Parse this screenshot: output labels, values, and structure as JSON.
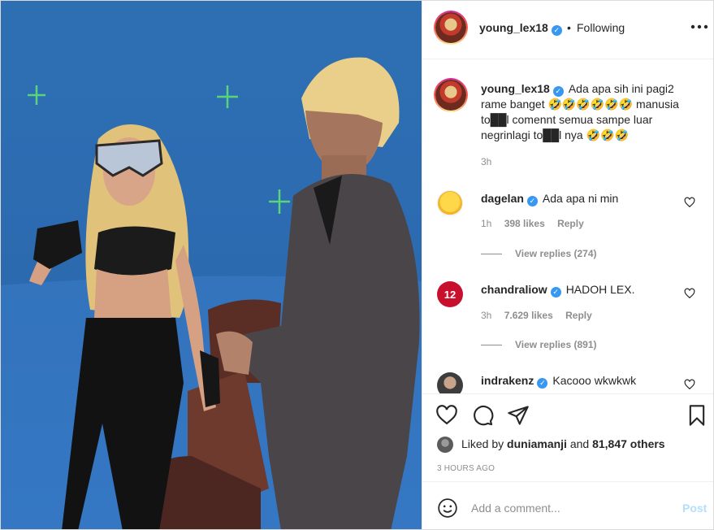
{
  "post": {
    "username": "young_lex18",
    "separator": "•",
    "follow_label": "Following",
    "more_label": "•••",
    "caption": "Ada apa sih ini pagi2 rame banget 🤣🤣🤣🤣🤣🤣 manusia to██l comennt semua sampe luar negrinlagi to██l nya 🤣🤣🤣",
    "caption_time": "3h"
  },
  "comments": [
    {
      "username": "dagelan",
      "text": "Ada apa ni min",
      "time": "1h",
      "likes": "398 likes",
      "reply_label": "Reply",
      "view_replies": "View replies (274)"
    },
    {
      "username": "chandraliow",
      "text": "HADOH LEX.",
      "time": "3h",
      "likes": "7.629 likes",
      "reply_label": "Reply",
      "view_replies": "View replies (891)"
    },
    {
      "username": "indrakenz",
      "text": "Kacooo wkwkwk"
    }
  ],
  "likes": {
    "prefix": "Liked by",
    "user": "duniamanji",
    "connector": "and",
    "others": "81,847 others"
  },
  "timestamp": "3 HOURS AGO",
  "add_comment": {
    "placeholder": "Add a comment...",
    "post_label": "Post"
  },
  "colors": {
    "verified_badge": "#3897f0",
    "post_button_disabled": "#b2dffc",
    "text_secondary": "#8e8e8e",
    "chroma_blue": "#2e6fb3",
    "tracking_mark": "#58d57a"
  }
}
